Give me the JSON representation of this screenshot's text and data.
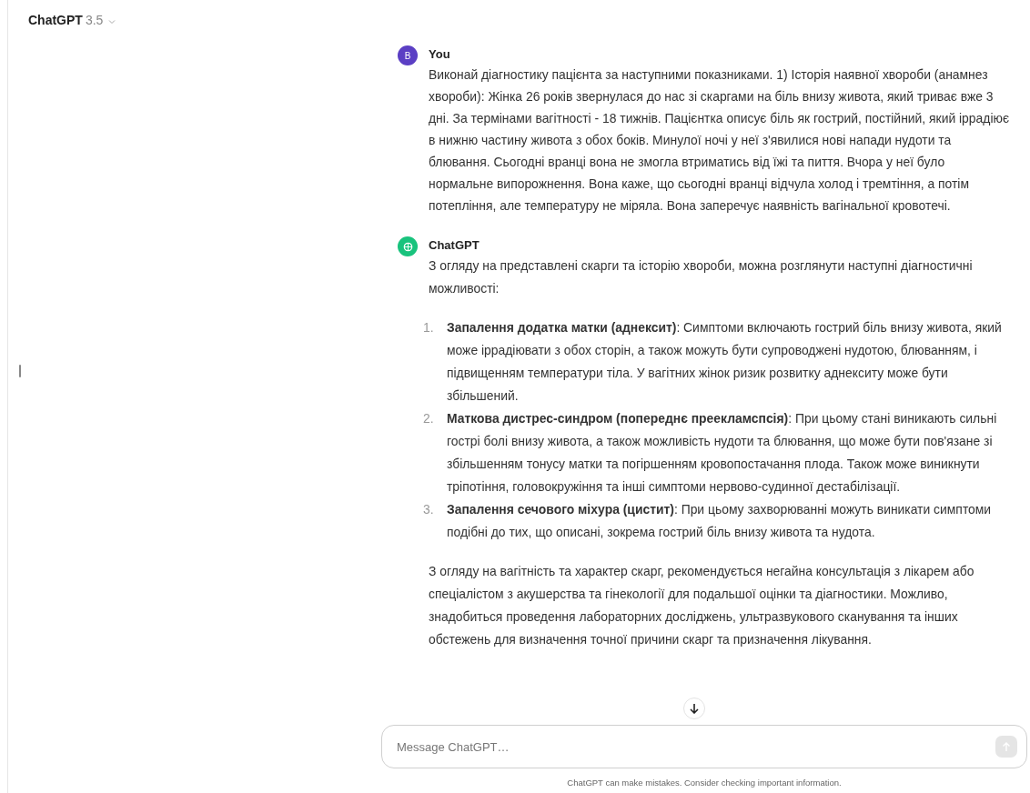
{
  "header": {
    "model_name": "ChatGPT",
    "model_version": "3.5"
  },
  "messages": [
    {
      "kind": "user",
      "avatar_letter": "B",
      "author": "You",
      "paragraphs": [
        "Виконай діагностику пацієнта за наступними показниками. 1) Історія наявної хвороби (анамнез хвороби): Жінка 26 років звернулася до нас зі скаргами на біль внизу живота, який триває вже 3 дні. За термінами вагітності - 18 тижнів. Пацієнтка описує біль як гострий, постійний, який іррадіює в нижню частину живота з обох боків. Минулої ночі у неї з'явилися нові напади нудоти та блювання. Сьогодні вранці вона не змогла втриматись від їжі та пиття. Вчора у неї було нормальне випорожнення. Вона каже, що сьогодні вранці відчула холод і тремтіння, а потім потепління, але температуру не міряла. Вона заперечує наявність вагінальної кровотечі."
      ]
    },
    {
      "kind": "assistant",
      "author": "ChatGPT",
      "paragraphs": [
        "З огляду на представлені скарги та історію хвороби, можна розглянути наступні діагностичні можливості:"
      ],
      "list": [
        {
          "number": "1.",
          "text": "**Запалення додатка матки (аднексит)**: Симптоми включають гострий біль внизу живота, який може іррадіювати з обох сторін, а також можуть бути супроводжені нудотою, блюванням, і підвищенням температури тіла. У вагітних жінок ризик розвитку аднекситу може бути збільшений."
        },
        {
          "number": "2.",
          "text": "**Маткова дистрес-синдром (попереднє преекламспсія)**: При цьому стані виникають сильні гострі болі внизу живота, а також можливість нудоти та блювання, що може бути пов'язане зі збільшенням тонусу матки та погіршенням кровопостачання плода. Також може виникнути тріпотіння, головокружіння та інші симптоми нервово-судинної дестабілізації."
        },
        {
          "number": "3.",
          "text": "**Запалення сечового міхура (цистит)**: При цьому захворюванні можуть виникати симптоми подібні до тих, що описані, зокрема гострий біль внизу живота та нудота."
        }
      ],
      "closing": "З огляду на вагітність та характер скарг, рекомендується негайна консультація з лікарем або спеціалістом з акушерства та гінекології для подальшої оцінки та діагностики. Можливо, знадобиться проведення лабораторних досліджень, ультразвукового сканування та інших обстежень для визначення точної причини скарг та призначення лікування."
    }
  ],
  "composer": {
    "placeholder": "Message ChatGPT…",
    "send_disabled": true
  },
  "disclaimer": "ChatGPT can make mistakes. Consider checking important information."
}
